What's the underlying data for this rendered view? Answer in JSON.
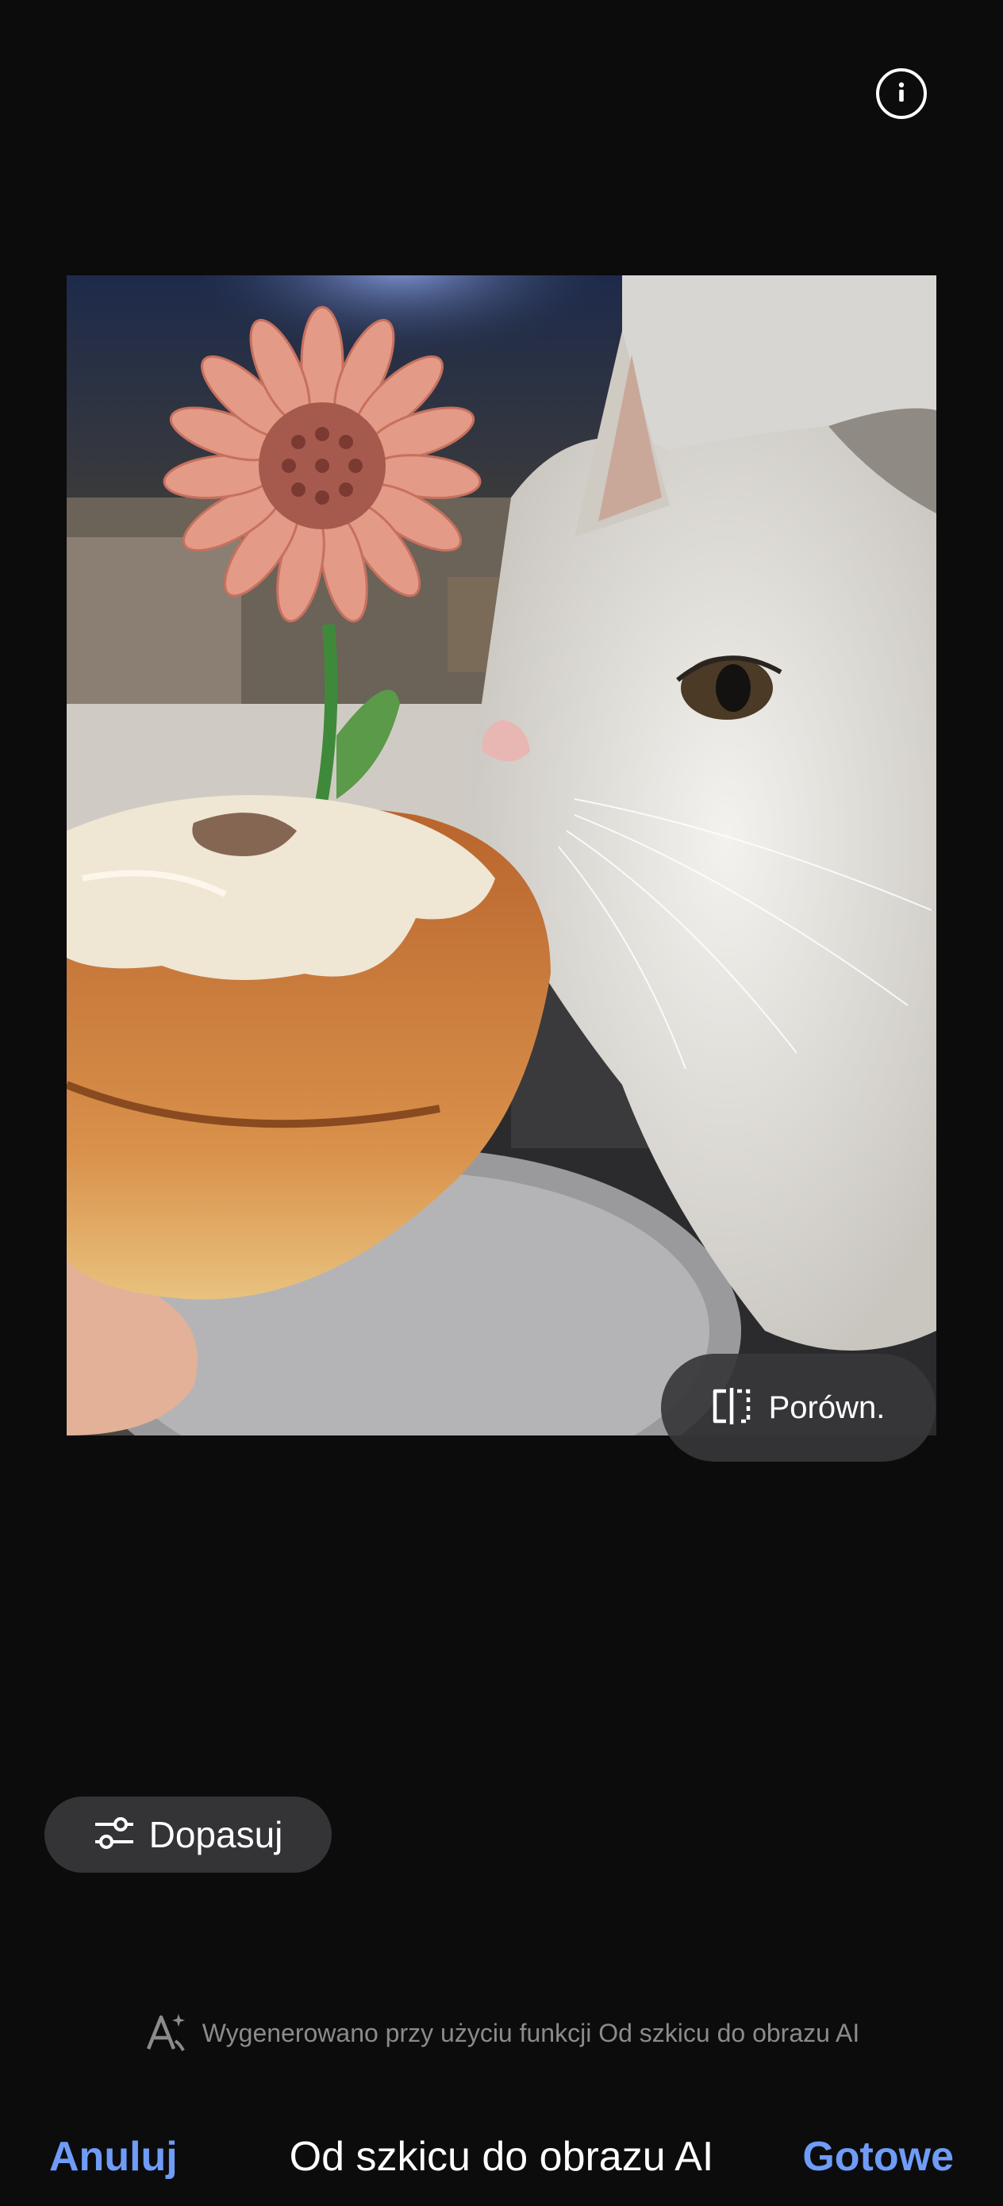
{
  "header": {
    "info_icon": "info-icon"
  },
  "photo": {
    "description_icon": "edited-photo"
  },
  "compare": {
    "label": "Porówn.",
    "icon": "compare-icon"
  },
  "adjust": {
    "label": "Dopasuj",
    "icon": "sliders-icon"
  },
  "ai_note": {
    "text": "Wygenerowano przy użyciu funkcji Od szkicu do obrazu AI",
    "icon": "ai-sparkle-icon"
  },
  "bottom_bar": {
    "cancel_label": "Anuluj",
    "title": "Od szkicu do obrazu AI",
    "done_label": "Gotowe"
  },
  "colors": {
    "accent": "#6f9cf7",
    "background": "#0c0c0d",
    "pill": "#343436"
  }
}
